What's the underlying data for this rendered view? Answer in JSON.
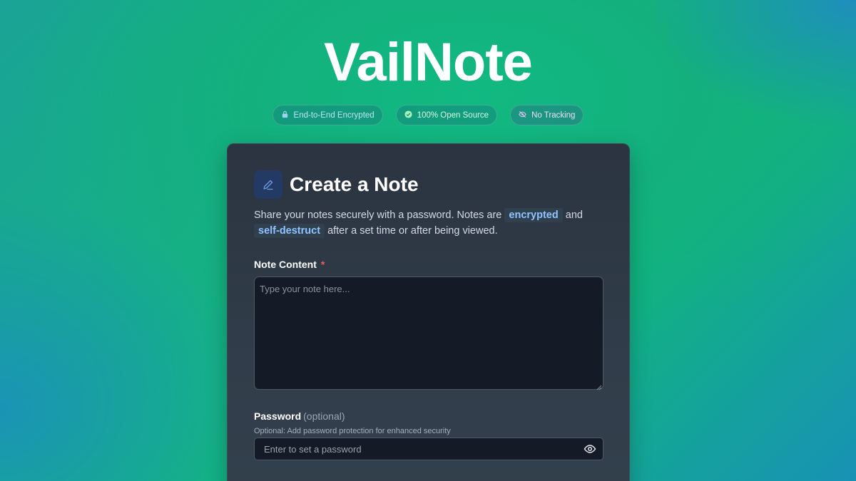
{
  "app": {
    "title": "VailNote"
  },
  "badges": [
    {
      "label": "End-to-End Encrypted",
      "icon": "lock-icon"
    },
    {
      "label": "100% Open Source",
      "icon": "check-circle-icon"
    },
    {
      "label": "No Tracking",
      "icon": "eye-off-icon"
    }
  ],
  "card": {
    "title": "Create a Note",
    "icon": "pencil-icon",
    "description": {
      "part1": "Share your notes securely with a password. Notes are",
      "highlight1": "encrypted",
      "part2": "and",
      "highlight2": "self-destruct",
      "part3": "after a set time or after being viewed."
    },
    "note_content": {
      "label": "Note Content",
      "required_mark": "*",
      "placeholder": "Type your note here..."
    },
    "password": {
      "label": "Password",
      "optional_tag": "(optional)",
      "hint": "Optional: Add password protection for enhanced security",
      "placeholder": "Enter to set a password",
      "toggle_icon": "eye-icon"
    }
  },
  "colors": {
    "accent": "#8fc4ff",
    "required": "#ef5b5b",
    "card_bg": "#2b3440",
    "input_bg": "#141a26"
  }
}
